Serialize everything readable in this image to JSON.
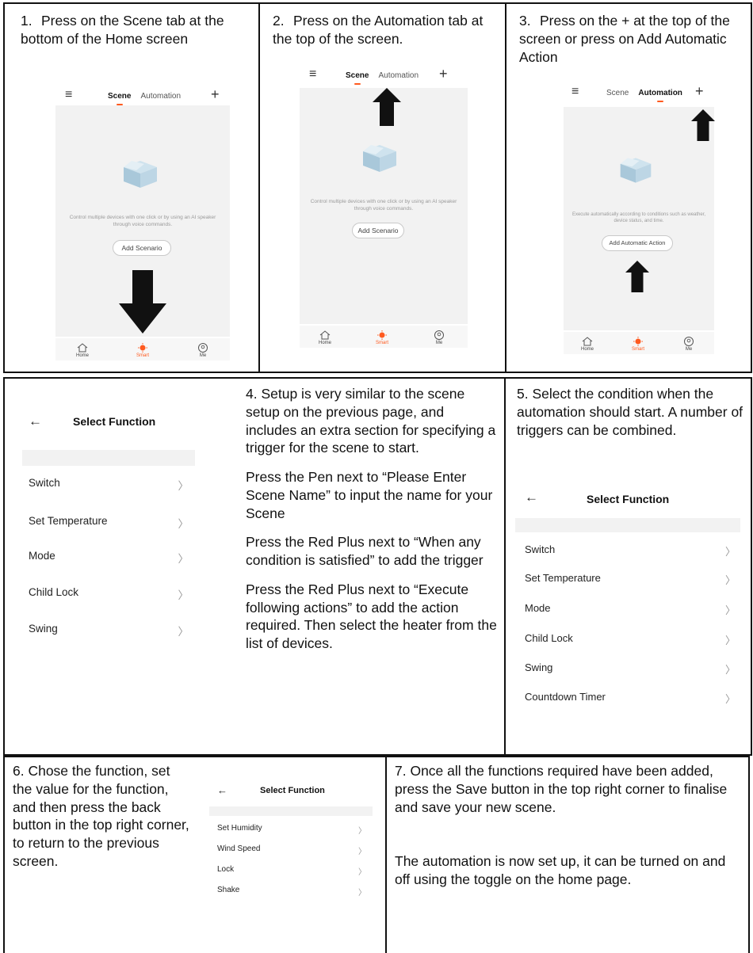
{
  "steps": {
    "s1": {
      "num": "1.",
      "text": "Press on the Scene tab at the bottom of the Home screen"
    },
    "s2": {
      "num": "2.",
      "text": "Press on the Automation tab at the top of the screen."
    },
    "s3": {
      "num": "3.",
      "text": "Press on the + at the top of the screen or press on Add Automatic Action"
    },
    "s4": {
      "p1": "4. Setup is very similar to the scene setup on the previous page, and includes an extra section for specifying a trigger for the scene to start.",
      "p2": "Press the Pen next to “Please Enter Scene Name” to input the name for your Scene",
      "p3": "Press the Red Plus next to “When any condition is satisfied” to add the trigger",
      "p4": "Press the Red Plus next to “Execute following actions” to add the action required.  Then select the heater from the list of devices."
    },
    "s5": {
      "text": "5. Select the condition when the automation should start.  A number of triggers can be combined."
    },
    "s6": {
      "text": "6. Chose the function, set the value for the function, and then press the back button in the top right corner, to return to the previous screen."
    },
    "s7": {
      "p1": "7. Once all the functions required have been added, press the Save button in the top right corner to finalise and save your new scene.",
      "p2": "The automation is now set up, it can be turned on and off using the toggle on the home page."
    }
  },
  "app": {
    "tab_scene": "Scene",
    "tab_automation": "Automation",
    "scene_desc": "Control multiple devices with one click or by using an AI speaker through voice commands.",
    "add_scenario": "Add Scenario",
    "auto_desc": "Execute automatically according to conditions such as weather, device status, and time.",
    "add_automatic_action": "Add Automatic Action",
    "nav_home": "Home",
    "nav_smart": "Smart",
    "nav_me": "Me",
    "accent_color": "#ff5a1f"
  },
  "select_function": {
    "title": "Select Function",
    "list_a": [
      "Switch",
      "Set Temperature",
      "Mode",
      "Child Lock",
      "Swing"
    ],
    "list_b": [
      "Switch",
      "Set Temperature",
      "Mode",
      "Child Lock",
      "Swing",
      "Countdown Timer"
    ],
    "list_c": [
      "Set Humidity",
      "Wind Speed",
      "Lock",
      "Shake"
    ],
    "chevron": "〉",
    "back": "←"
  }
}
